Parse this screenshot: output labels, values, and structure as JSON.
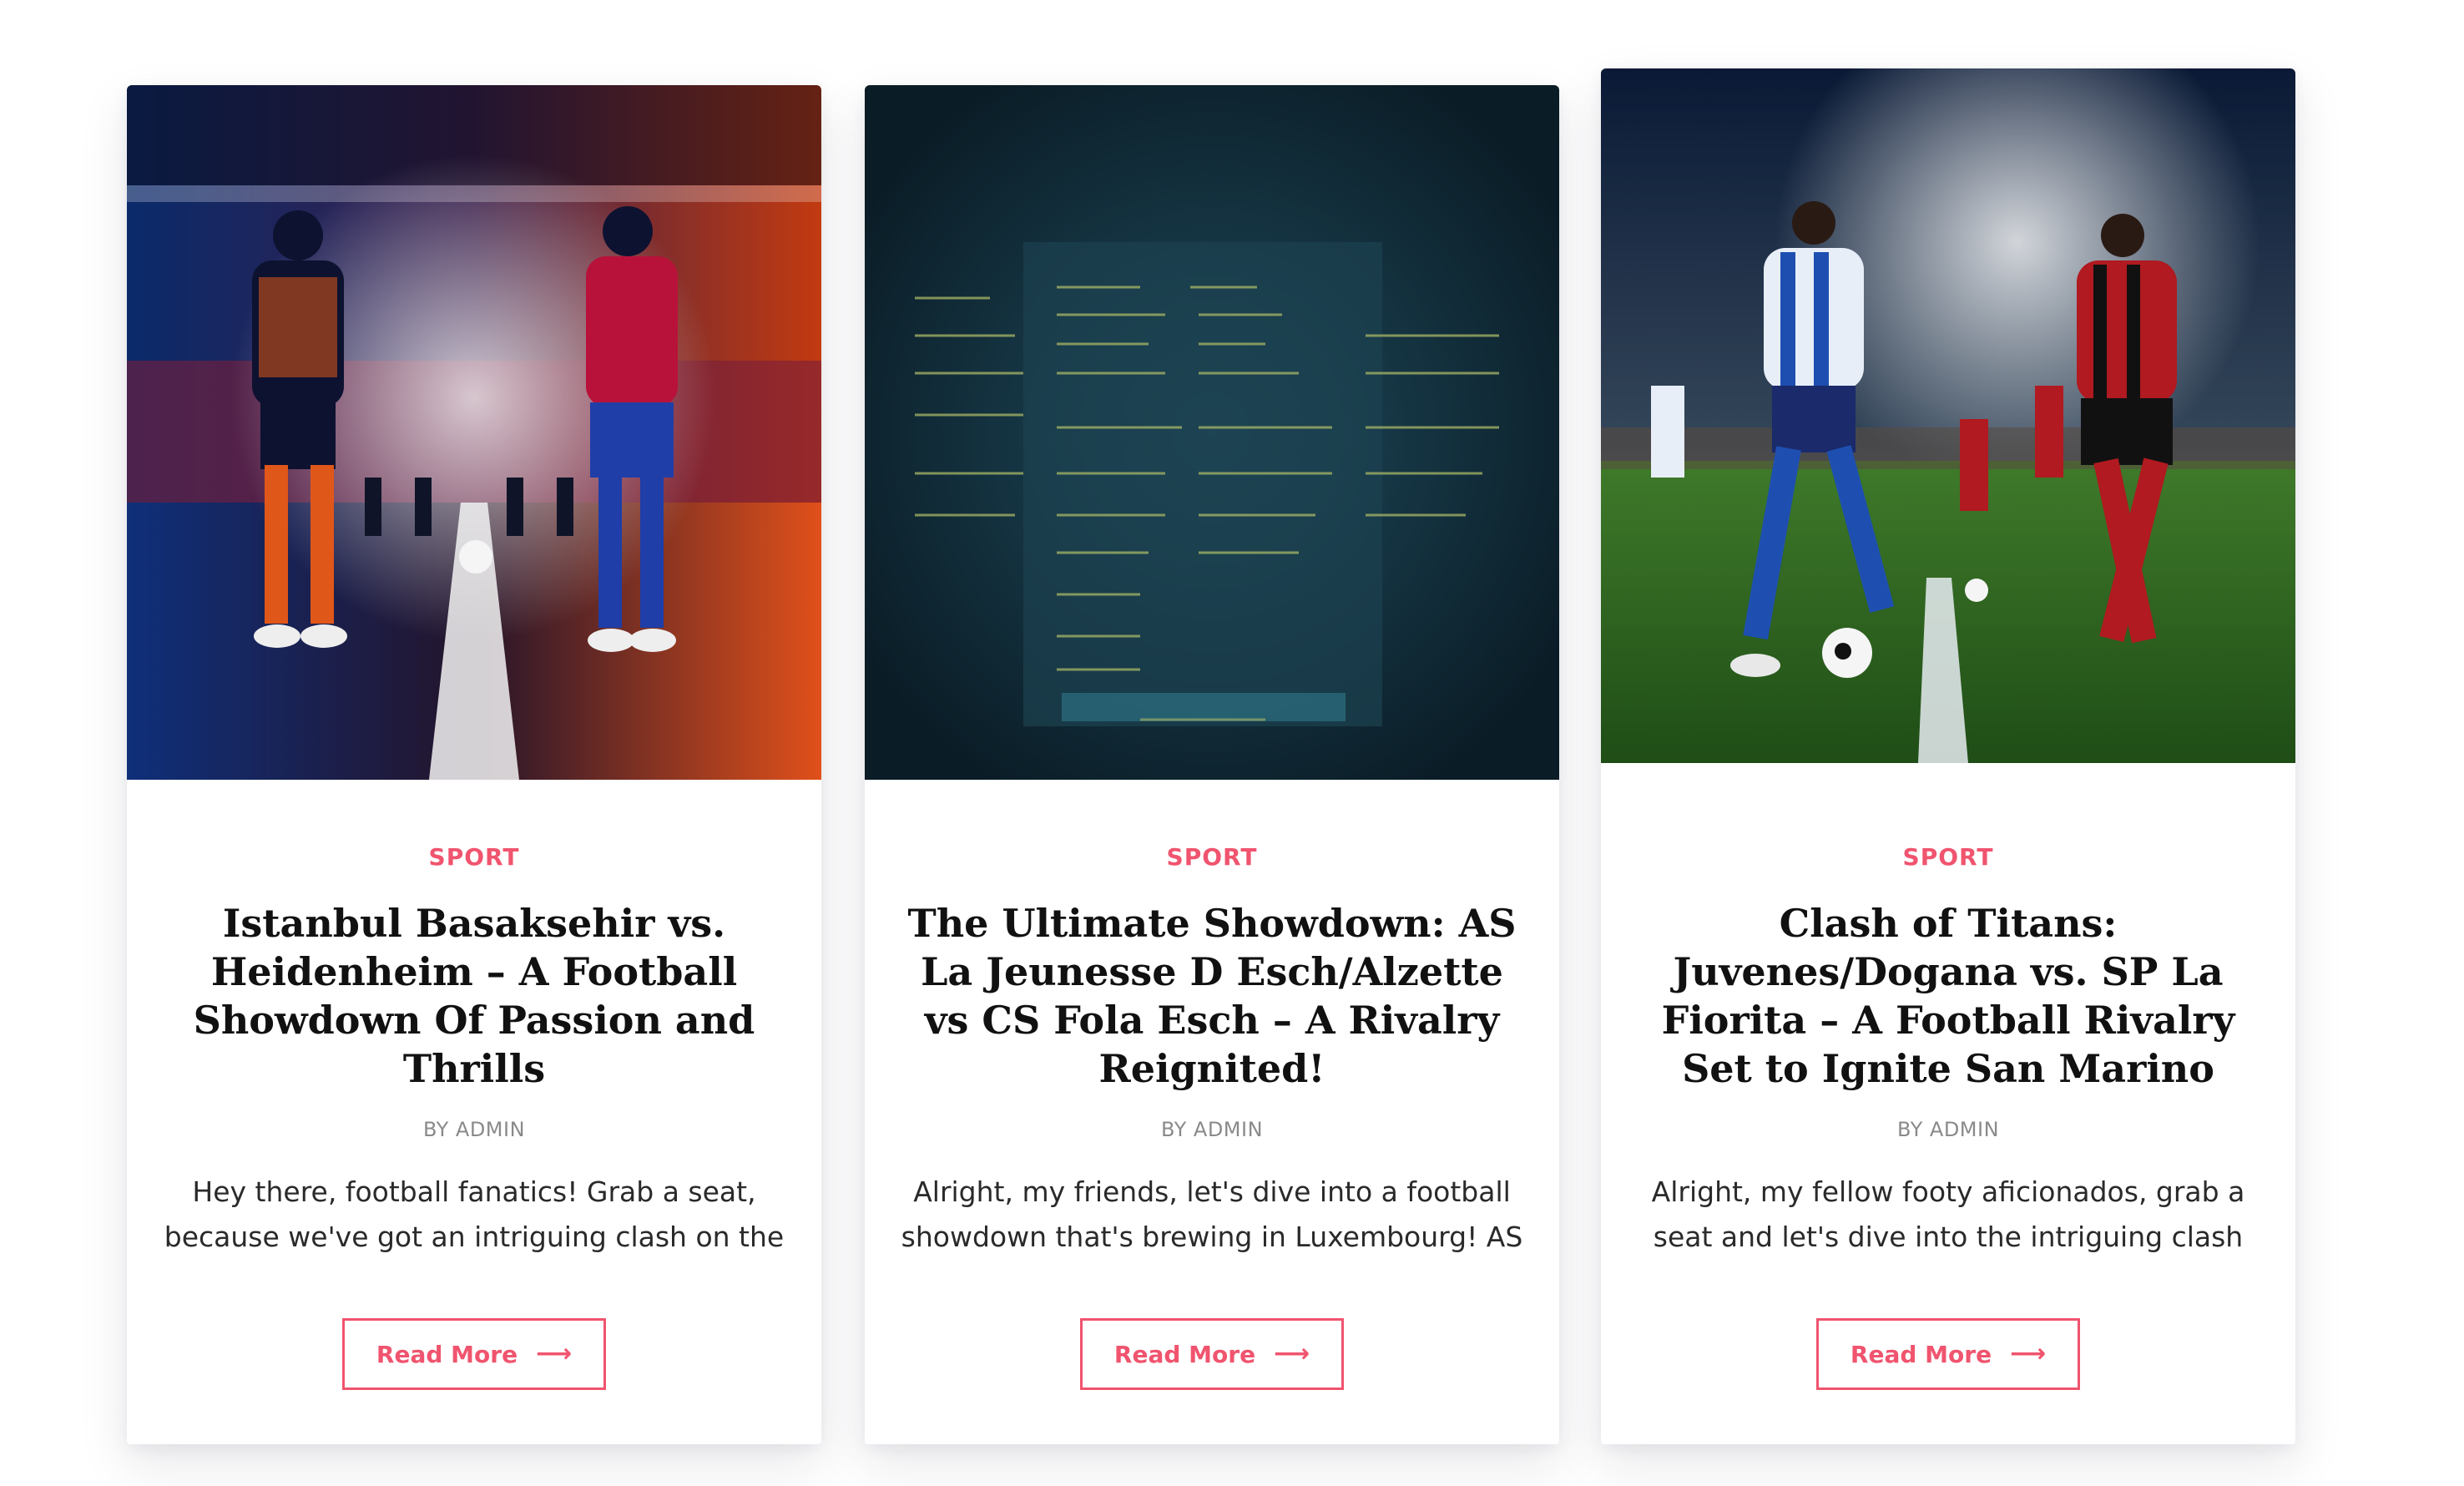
{
  "posts": [
    {
      "category": "Sport",
      "title": "Istanbul Basaksehir vs. Heidenheim – A Football Showdown Of Passion and Thrills",
      "author": "BY ADMIN",
      "excerpt": "Hey there, football fanatics! Grab a seat, because we've got an intriguing clash on the",
      "button": "Read More",
      "arrow": "⟶"
    },
    {
      "category": "Sport",
      "title": "The Ultimate Showdown: AS La Jeunesse D Esch/Alzette vs CS Fola Esch – A Rivalry Reignited!",
      "author": "BY ADMIN",
      "excerpt": "Alright, my friends, let's dive into a football showdown that's brewing in Luxembourg! AS La",
      "button": "Read More",
      "arrow": "⟶"
    },
    {
      "category": "Sport",
      "title": "Clash of Titans: Juvenes/Dogana vs. SP La Fiorita – A Football Rivalry Set to Ignite San Marino",
      "author": "BY ADMIN",
      "excerpt": "Alright, my fellow footy aficionados, grab a seat and let's dive into the intriguing clash",
      "button": "Read More",
      "arrow": "⟶"
    }
  ],
  "colors": {
    "accent": "#f0546e",
    "title": "#111111",
    "meta": "#8a8a8a"
  }
}
